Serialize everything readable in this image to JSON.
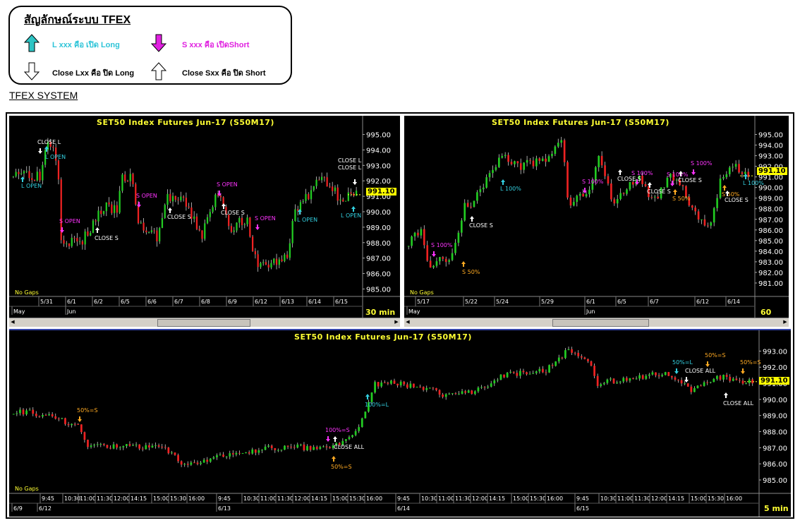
{
  "legend": {
    "title": "สัญลักษณ์ระบบ TFEX",
    "items": [
      {
        "text": "L xxx คือ เปิด Long",
        "color": "#2ec4d8"
      },
      {
        "text": "S xxx คือ เปิดShort",
        "color": "#e020e0"
      },
      {
        "text": "Close Lxx คือ ปิด Long",
        "color": "#000000"
      },
      {
        "text": "Close Sxx คือ ปิด Short",
        "color": "#000000"
      }
    ]
  },
  "system_title": "TFEX SYSTEM",
  "panels": {
    "p30": {
      "title": "SET50  Index  Futures  Jun-17  (S50M17)",
      "interval": "30  min",
      "last_price": "991.10",
      "nogaps": "No Gaps",
      "y_ticks": [
        "995.00",
        "994.00",
        "993.00",
        "992.00",
        "991.00",
        "990.00",
        "989.00",
        "988.00",
        "987.00",
        "986.00",
        "985.00"
      ],
      "x_ticks_top": [
        "5/31",
        "6/1",
        "6/2",
        "6/5",
        "6/6",
        "6/7",
        "6/8",
        "6/9",
        "6/12",
        "6/13",
        "6/14",
        "6/15"
      ],
      "x_ticks_bottom": [
        "May",
        "Jun"
      ],
      "signals": [
        "CLOSE  L",
        "L  OPEN",
        "L  OPEN",
        "S  OPEN",
        "CLOSE  S",
        "S  OPEN",
        "CLOSE  S",
        "S  OPEN",
        "CLOSE  S",
        "S  OPEN",
        "L  OPEN",
        "CLOSE  L",
        "CLOSE  L",
        "L  OPEN"
      ]
    },
    "p60": {
      "title": "SET50  Index  Futures  Jun-17  (S50M17)",
      "interval": "60  min",
      "last_price": "991.10",
      "nogaps": "No Gaps",
      "y_ticks": [
        "995.00",
        "994.00",
        "993.00",
        "992.00",
        "991.00",
        "990.00",
        "989.00",
        "988.00",
        "987.00",
        "986.00",
        "985.00",
        "984.00",
        "983.00",
        "982.00",
        "981.00"
      ],
      "x_ticks_top": [
        "5/17",
        "5/22",
        "5/24",
        "5/29",
        "6/1",
        "6/5",
        "6/7",
        "6/12",
        "6/14"
      ],
      "x_ticks_bottom": [
        "May",
        "Jun"
      ],
      "signals": [
        "S  100%",
        "S  50%",
        "CLOSE  S",
        "L  100%",
        "S  100%",
        "CLOSE  S",
        "S  100%",
        "CLOSE  S",
        "S  50%",
        "S  100%",
        "CLOSE  S",
        "S  100%",
        "S  50%",
        "CLOSE  S",
        "L  100%"
      ]
    },
    "p5": {
      "title": "SET50  Index  Futures  Jun-17  (S50M17)",
      "interval": "5  min",
      "last_price": "991.10",
      "nogaps": "No Gaps",
      "y_ticks": [
        "993.00",
        "992.00",
        "991.00",
        "990.00",
        "989.00",
        "988.00",
        "987.00",
        "986.00",
        "985.00"
      ],
      "x_ticks_top": [
        "9:45",
        "10:30",
        "11:00",
        "11:30",
        "12:00",
        "14:15",
        "15:00",
        "15:30",
        "16:00",
        "9:45",
        "10:30",
        "11:00",
        "11:30",
        "12:00",
        "14:15",
        "15:00",
        "15:30",
        "16:00",
        "9:45",
        "10:30",
        "11:00",
        "11:30",
        "12:00",
        "14:15",
        "15:00",
        "15:30",
        "16:00",
        "9:45",
        "10:30",
        "11:00",
        "11:30",
        "12:00",
        "14:15",
        "15:00",
        "15:30",
        "16:00"
      ],
      "x_ticks_bottom": [
        "6/9",
        "6/12",
        "6/13",
        "6/14",
        "6/15"
      ],
      "signals": [
        "50%=S",
        "100%=S",
        "CLOSE  ALL",
        "50%=S",
        "100%=L",
        "50%=L",
        "CLOSE  ALL",
        "50%=S",
        "CLOSE  ALL",
        "50%=S"
      ]
    }
  },
  "colors": {
    "up": "#22cc22",
    "down": "#ee2222",
    "cyan": "#33d0e0",
    "magenta": "#ff33ff",
    "orange": "#ffaa22",
    "white": "#ffffff",
    "yellow": "#ffff33"
  }
}
